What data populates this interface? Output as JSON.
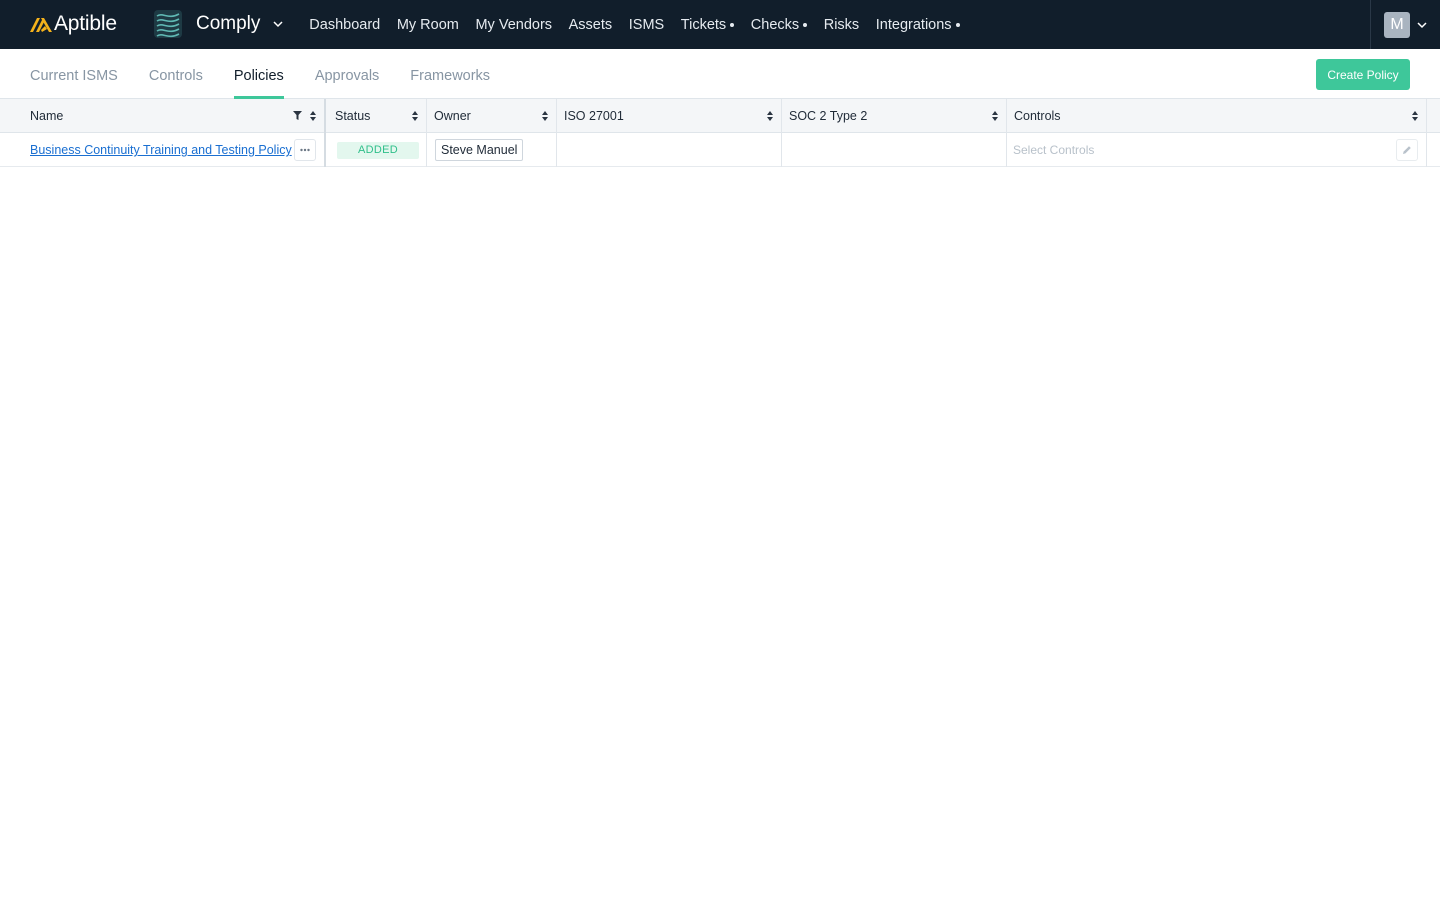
{
  "app": {
    "brand": "Aptible",
    "product": "Comply"
  },
  "nav": {
    "items": [
      {
        "label": "Dashboard",
        "dot": false
      },
      {
        "label": "My Room",
        "dot": false
      },
      {
        "label": "My Vendors",
        "dot": false
      },
      {
        "label": "Assets",
        "dot": false
      },
      {
        "label": "ISMS",
        "dot": false
      },
      {
        "label": "Tickets",
        "dot": true
      },
      {
        "label": "Checks",
        "dot": true
      },
      {
        "label": "Risks",
        "dot": false
      },
      {
        "label": "Integrations",
        "dot": true
      }
    ]
  },
  "user": {
    "initial": "M"
  },
  "tabs": {
    "current_isms": "Current ISMS",
    "controls": "Controls",
    "policies": "Policies",
    "approvals": "Approvals",
    "frameworks": "Frameworks",
    "active": "Policies"
  },
  "toolbar": {
    "create_label": "Create Policy"
  },
  "table": {
    "headers": {
      "name": "Name",
      "status": "Status",
      "owner": "Owner",
      "iso": "ISO 27001",
      "soc": "SOC 2 Type 2",
      "controls": "Controls"
    },
    "rows": [
      {
        "name": "Business Continuity Training and Testing Policy",
        "status": "ADDED",
        "owner": "Steve Manuel",
        "iso": "",
        "soc": "",
        "controls_placeholder": "Select Controls"
      }
    ]
  },
  "colors": {
    "topbar": "#111e2b",
    "accent": "#3ec79a",
    "link": "#1a6fd1",
    "brand_mark": "#f5b21b"
  },
  "icons": {
    "brand": "aptible-logo-icon",
    "product": "comply-logo-icon",
    "dropdown": "chevron-down-icon",
    "filter": "filter-icon",
    "sort": "sort-icon",
    "more": "more-dots-icon",
    "edit": "pencil-icon"
  }
}
